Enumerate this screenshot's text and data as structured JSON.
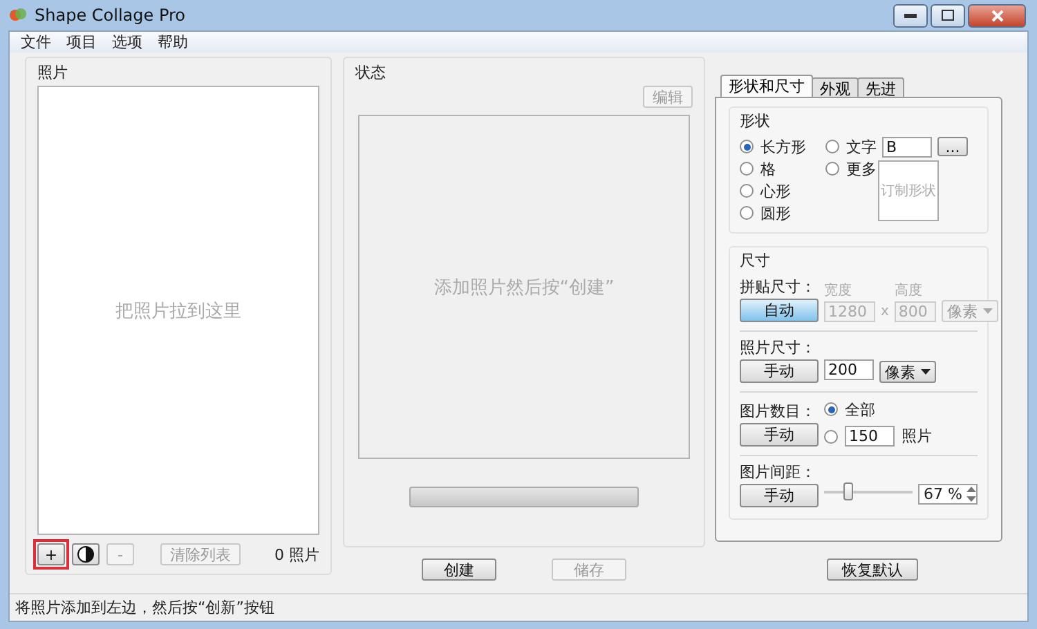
{
  "window": {
    "title": "Shape Collage Pro"
  },
  "menu": [
    "文件",
    "项目",
    "选项",
    "帮助"
  ],
  "photos_panel": {
    "title": "照片",
    "placeholder": "把照片拉到这里",
    "buttons": [
      {
        "kind": "text",
        "label": "+",
        "disabled": false,
        "highlighted": true
      },
      {
        "kind": "icon",
        "disabled": false
      },
      {
        "kind": "text",
        "label": "-",
        "disabled": true
      }
    ],
    "clear_button": {
      "label": "清除列表",
      "disabled": true
    },
    "count": "0 照片"
  },
  "status_panel": {
    "title": "状态",
    "edit_button": {
      "label": "编辑",
      "disabled": true
    },
    "preview_hint": "添加照片然后按“创建”",
    "progress": {
      "level": 0
    }
  },
  "actions": [
    {
      "label": "创建",
      "disabled": false
    },
    {
      "label": "储存",
      "disabled": true
    }
  ],
  "tabs": [
    {
      "label": "形状和尺寸",
      "selected": true
    },
    {
      "label": "外观",
      "selected": false
    },
    {
      "label": "先进",
      "selected": false
    }
  ],
  "shape": {
    "title": "形状",
    "options": [
      {
        "kind": "plain",
        "label": "长方形",
        "selected": true
      },
      {
        "kind": "plain",
        "label": "格",
        "selected": false
      },
      {
        "kind": "plain",
        "label": "心形",
        "selected": false
      },
      {
        "kind": "plain",
        "label": "圆形",
        "selected": false
      },
      {
        "kind": "text",
        "label": "文字",
        "selected": false,
        "value": "B",
        "browse": "..."
      },
      {
        "kind": "more",
        "label": "更多",
        "selected": false,
        "custom": "订制形状"
      }
    ]
  },
  "size": {
    "title": "尺寸",
    "rows": [
      {
        "kind": "canvas",
        "label": "拼贴尺寸：",
        "mode": {
          "label": "自动",
          "selected": true
        },
        "width": {
          "label": "宽度",
          "value": "1280",
          "disabled": true
        },
        "separator": "x",
        "height": {
          "label": "高度",
          "value": "800",
          "disabled": true
        },
        "unit": {
          "value": "像素",
          "disabled": true
        }
      },
      {
        "kind": "photo",
        "label": "照片尺寸：",
        "mode": {
          "label": "手动",
          "selected": false
        },
        "value": "200",
        "unit": {
          "value": "像素",
          "disabled": false
        }
      },
      {
        "kind": "count",
        "label": "图片数目：",
        "mode": {
          "label": "手动",
          "selected": false
        },
        "options": [
          {
            "label": "全部",
            "selected": true
          },
          {
            "value": "150",
            "unit": "照片",
            "selected": false
          }
        ]
      },
      {
        "kind": "spacing",
        "label": "图片间距：",
        "mode": {
          "label": "手动",
          "selected": false
        },
        "level": 0.28,
        "value": "67 %"
      }
    ]
  },
  "reset_button": "恢复默认",
  "status_bar": "将照片添加到左边，然后按“创新”按钮"
}
